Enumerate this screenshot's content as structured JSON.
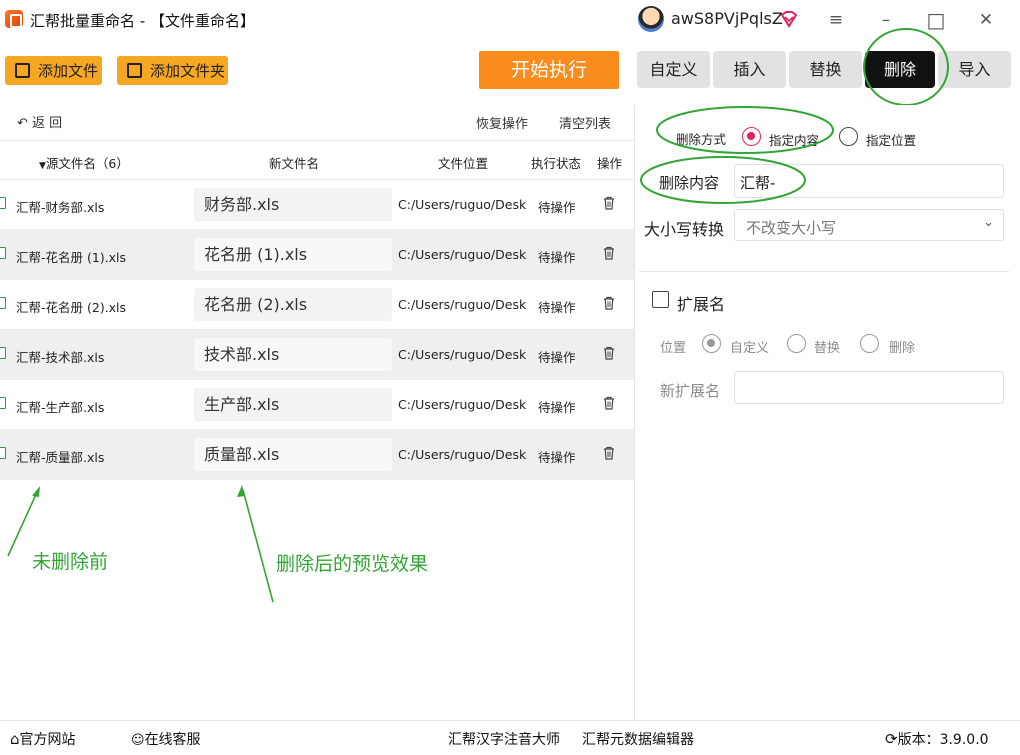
{
  "window": {
    "title": "汇帮批量重命名 - 【文件重命名】",
    "username": "awS8PVjPqlsZ",
    "controls": [
      "≡",
      "–",
      "□",
      "✕"
    ]
  },
  "toolbar": {
    "add_file": "添加文件",
    "add_folder": "添加文件夹",
    "start": "开始执行"
  },
  "tabs": [
    {
      "label": "自定义",
      "active": false
    },
    {
      "label": "插入",
      "active": false
    },
    {
      "label": "替换",
      "active": false
    },
    {
      "label": "删除",
      "active": true
    },
    {
      "label": "导入",
      "active": false
    }
  ],
  "list": {
    "back": "返 回",
    "undo": "恢复操作",
    "clear": "清空列表",
    "columns": {
      "source": "源文件名（6）",
      "new_name": "新文件名",
      "location": "文件位置",
      "status": "执行状态",
      "action": "操作"
    },
    "rows": [
      {
        "source": "汇帮-财务部.xls",
        "new_name": "财务部.xls",
        "location": "C:/Users/ruguo/Desktop",
        "status": "待操作"
      },
      {
        "source": "汇帮-花名册 (1).xls",
        "new_name": "花名册 (1).xls",
        "location": "C:/Users/ruguo/Desktop",
        "status": "待操作"
      },
      {
        "source": "汇帮-花名册 (2).xls",
        "new_name": "花名册 (2).xls",
        "location": "C:/Users/ruguo/Desktop",
        "status": "待操作"
      },
      {
        "source": "汇帮-技术部.xls",
        "new_name": "技术部.xls",
        "location": "C:/Users/ruguo/Desktop",
        "status": "待操作"
      },
      {
        "source": "汇帮-生产部.xls",
        "new_name": "生产部.xls",
        "location": "C:/Users/ruguo/Desktop",
        "status": "待操作"
      },
      {
        "source": "汇帮-质量部.xls",
        "new_name": "质量部.xls",
        "location": "C:/Users/ruguo/Desktop",
        "status": "待操作"
      }
    ]
  },
  "annotations": {
    "before": "未删除前",
    "after": "删除后的预览效果",
    "color": "#33a534"
  },
  "delete_panel": {
    "mode_label": "删除方式",
    "mode_options": [
      "指定内容",
      "指定位置"
    ],
    "mode_selected": "指定内容",
    "content_label": "删除内容",
    "content_value": "汇帮-",
    "case_label": "大小写转换",
    "case_value": "不改变大小写",
    "ext_label": "扩展名",
    "ext_checked": false,
    "position_label": "位置",
    "position_options": [
      "自定义",
      "替换",
      "删除"
    ],
    "position_selected": "自定义",
    "new_ext_label": "新扩展名",
    "new_ext_value": ""
  },
  "statusbar": {
    "website": "官方网站",
    "support": "在线客服",
    "tool1": "汇帮汉字注音大师",
    "tool2": "汇帮元数据编辑器",
    "version": "版本：3.9.0.0"
  },
  "colors": {
    "accent_orange": "#f5a623",
    "start_orange": "#f98c1c",
    "radio_pink": "#e0245e",
    "annotation_green": "#33a534"
  }
}
